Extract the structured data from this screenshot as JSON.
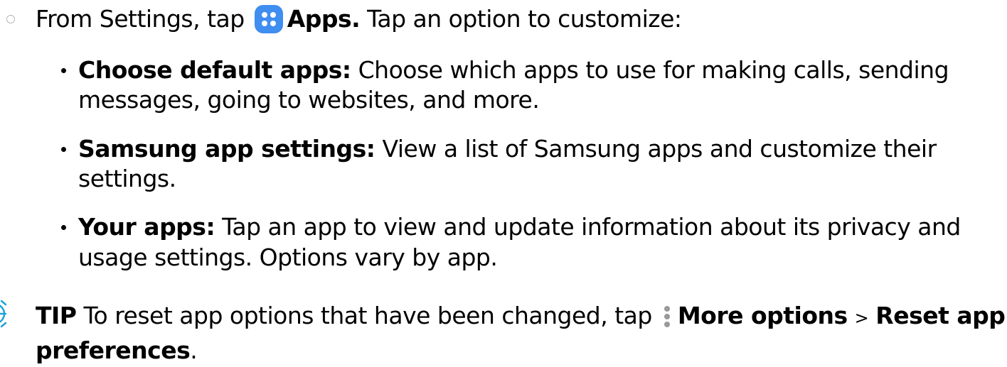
{
  "intro": {
    "lead": "From Settings, tap",
    "apps_label": "Apps.",
    "tail": "Tap an option to customize:",
    "apps_icon": "apps-grid-icon"
  },
  "options": [
    {
      "title": "Choose default apps:",
      "desc_line1": "Choose which apps to use for making calls, sending",
      "desc_line2": "messages, going to websites, and more."
    },
    {
      "title": "Samsung app settings:",
      "desc_line1": "View a list of Samsung apps and customize their",
      "desc_line2": "settings."
    },
    {
      "title": "Your apps:",
      "desc_line1": "Tap an app to view and update information about its privacy and",
      "desc_line2": "usage settings. Options vary by app."
    }
  ],
  "tip": {
    "label": "TIP",
    "text": "To reset app options that have been changed, tap",
    "more_options": "More options",
    "separator": ">",
    "reset_label_part1": "Reset app",
    "reset_label_part2": "preferences",
    "end": ".",
    "tip_icon": "lightbulb-icon",
    "more_icon": "more-options-icon"
  },
  "colors": {
    "apps_icon_bg": "#3f8ef0",
    "tip_icon": "#1ea1d7",
    "text": "#000000"
  }
}
